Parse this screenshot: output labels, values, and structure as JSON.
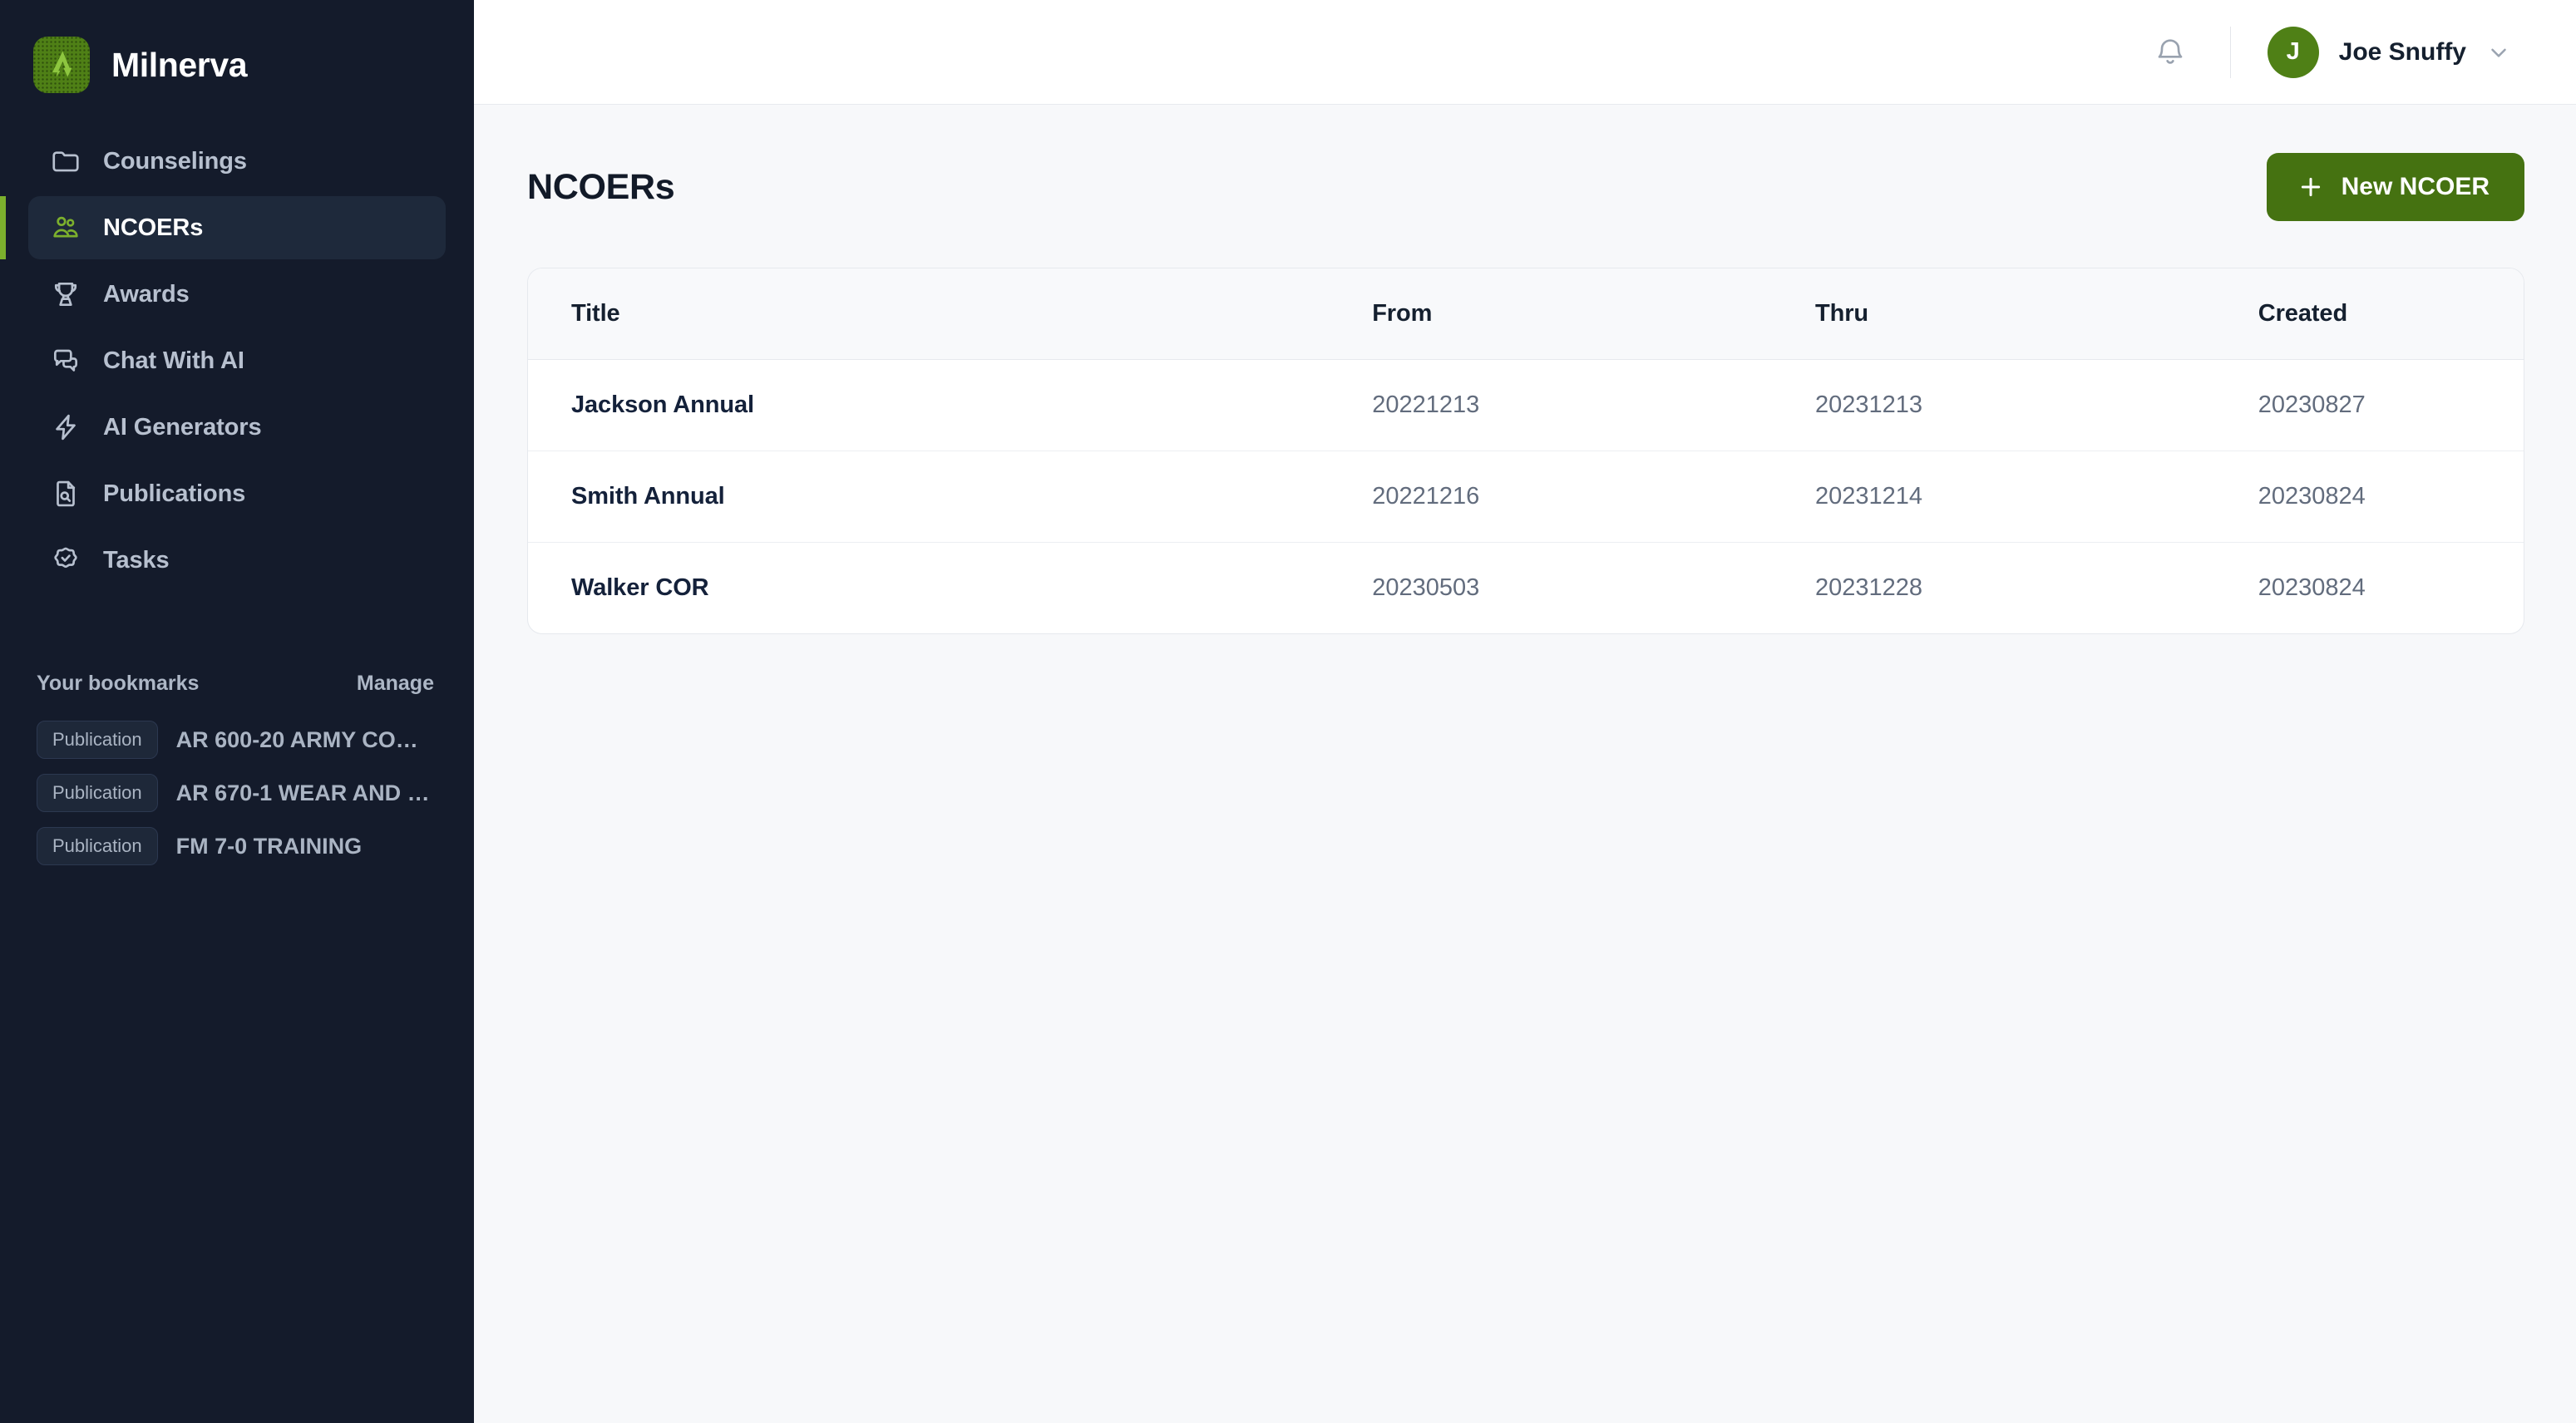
{
  "brand": {
    "name": "Milnerva",
    "logo_icon": "milnerva-logo-mark",
    "logo_bg": "#4f8016",
    "logo_mark_color": "#8dc63f"
  },
  "sidebar": {
    "nav": [
      {
        "label": "Counselings",
        "icon": "folder-icon",
        "active": false
      },
      {
        "label": "NCOERs",
        "icon": "users-icon",
        "active": true
      },
      {
        "label": "Awards",
        "icon": "trophy-icon",
        "active": false
      },
      {
        "label": "Chat With AI",
        "icon": "chat-bubbles-icon",
        "active": false
      },
      {
        "label": "AI Generators",
        "icon": "lightning-icon",
        "active": false
      },
      {
        "label": "Publications",
        "icon": "file-search-icon",
        "active": false
      },
      {
        "label": "Tasks",
        "icon": "badge-check-icon",
        "active": false
      }
    ],
    "bookmarks": {
      "title": "Your bookmarks",
      "manage_label": "Manage",
      "items": [
        {
          "badge": "Publication",
          "label": "AR 600-20 ARMY CO…"
        },
        {
          "badge": "Publication",
          "label": "AR 670-1 WEAR AND …"
        },
        {
          "badge": "Publication",
          "label": "FM 7-0 TRAINING"
        }
      ]
    },
    "active_accent": "#7cb02d",
    "background": "#141b2b"
  },
  "topbar": {
    "notifications_icon": "bell-icon",
    "user": {
      "initial": "J",
      "name": "Joe Snuffy",
      "avatar_color": "#4f8016",
      "chevron_icon": "chevron-down-icon"
    }
  },
  "page": {
    "title": "NCOERs",
    "primary_action": {
      "label": "New NCOER",
      "icon": "plus-icon",
      "color": "#457211"
    }
  },
  "table": {
    "columns": [
      "Title",
      "From",
      "Thru",
      "Created"
    ],
    "rows": [
      {
        "title": "Jackson Annual",
        "from": "20221213",
        "thru": "20231213",
        "created": "20230827"
      },
      {
        "title": "Smith Annual",
        "from": "20221216",
        "thru": "20231214",
        "created": "20230824"
      },
      {
        "title": "Walker COR",
        "from": "20230503",
        "thru": "20231228",
        "created": "20230824"
      }
    ]
  }
}
